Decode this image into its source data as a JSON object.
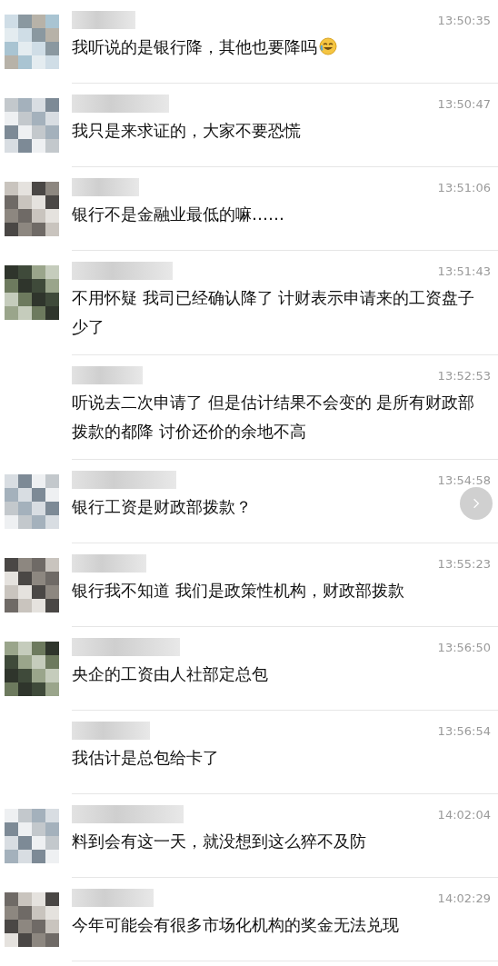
{
  "messages": [
    {
      "kind": "first",
      "time": "13:50:35",
      "text": "我听说的是银行降，其他也要降吗",
      "emoji": true
    },
    {
      "kind": "first",
      "time": "13:50:47",
      "text": "我只是来求证的，大家不要恐慌",
      "emoji": false
    },
    {
      "kind": "first",
      "time": "13:51:06",
      "text": "银行不是金融业最低的嘛……",
      "emoji": false
    },
    {
      "kind": "first",
      "time": "13:51:43",
      "text": "不用怀疑 我司已经确认降了 计财表示申请来的工资盘子少了",
      "emoji": false
    },
    {
      "kind": "continued",
      "time": "13:52:53",
      "text": "听说去二次申请了 但是估计结果不会变的 是所有财政部拨款的都降 讨价还价的余地不高",
      "emoji": false
    },
    {
      "kind": "first",
      "time": "13:54:58",
      "text": "银行工资是财政部拨款？",
      "emoji": false
    },
    {
      "kind": "first",
      "time": "13:55:23",
      "text": "银行我不知道 我们是政策性机构，财政部拨款",
      "emoji": false
    },
    {
      "kind": "first",
      "time": "13:56:50",
      "text": "央企的工资由人社部定总包",
      "emoji": false
    },
    {
      "kind": "continued",
      "time": "13:56:54",
      "text": "我估计是总包给卡了",
      "emoji": false
    },
    {
      "kind": "first",
      "time": "14:02:04",
      "text": "料到会有这一天，就没想到这么猝不及防",
      "emoji": false
    },
    {
      "kind": "first",
      "time": "14:02:29",
      "text": "今年可能会有很多市场化机构的奖金无法兑现",
      "emoji": false
    }
  ]
}
